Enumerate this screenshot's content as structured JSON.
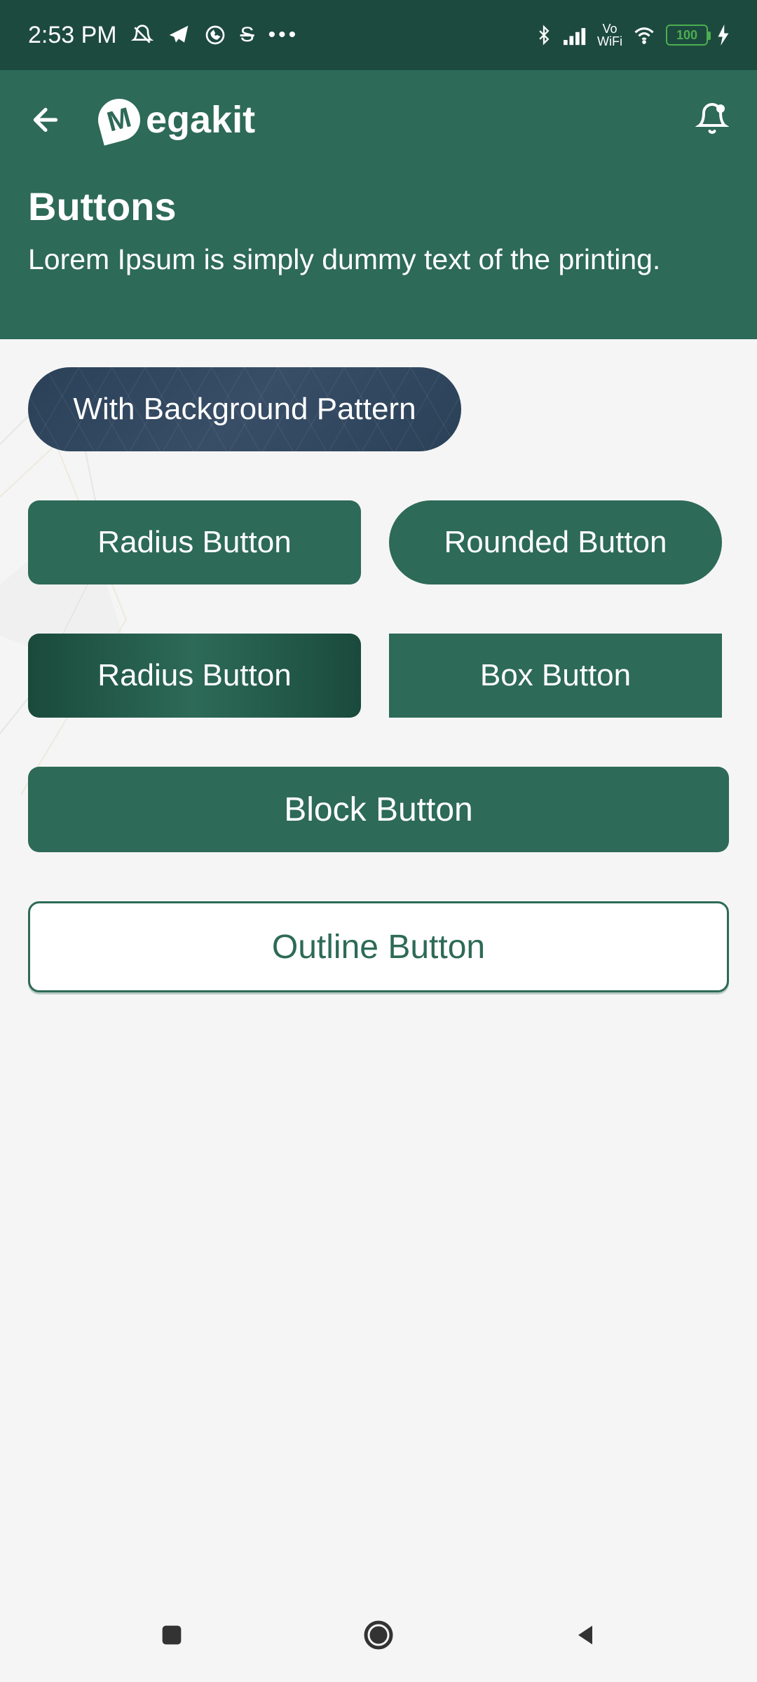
{
  "statusBar": {
    "time": "2:53 PM",
    "battery": "100"
  },
  "header": {
    "appName": "egakit"
  },
  "page": {
    "title": "Buttons",
    "subtitle": "Lorem Ipsum is simply dummy text of the printing."
  },
  "buttons": {
    "pattern": "With Background Pattern",
    "radius1": "Radius Button",
    "rounded": "Rounded Button",
    "radius2": "Radius Button",
    "box": "Box Button",
    "block": "Block Button",
    "outline": "Outline Button"
  }
}
